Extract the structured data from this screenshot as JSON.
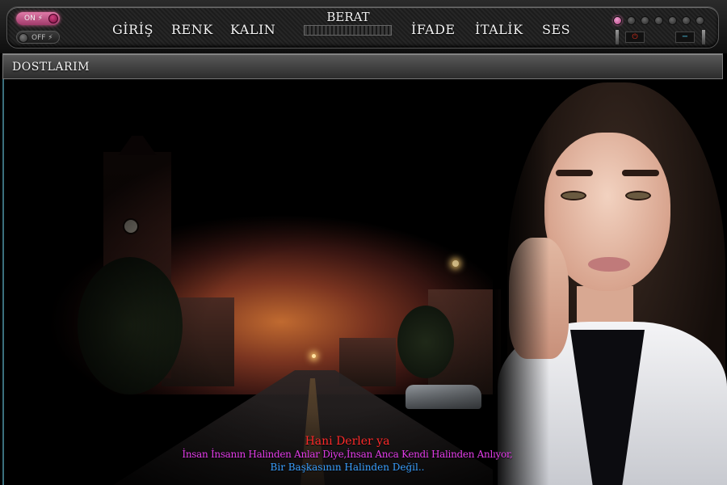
{
  "toolbar": {
    "on_label": "ON ⚡",
    "off_label": "OFF ⚡",
    "nav": [
      "GİRİŞ",
      "RENK",
      "KALIN",
      "İFADE",
      "İTALİK",
      "SES"
    ],
    "brand": "BERAT",
    "power_icon": "⏻",
    "minus_icon": "−",
    "accent_color": "#d06090"
  },
  "section": {
    "title": "DOSTLARIM"
  },
  "poem": {
    "line1": "Hani Derler ya",
    "line2": "İnsan İnsanın Halinden Anlar Diye,İnsan Anca Kendi Halinden Anlıyor,",
    "line3": "Bir Başkasının Halinden Değil..",
    "colors": [
      "#ff2a2a",
      "#e23ce8",
      "#3aa0ff"
    ]
  }
}
